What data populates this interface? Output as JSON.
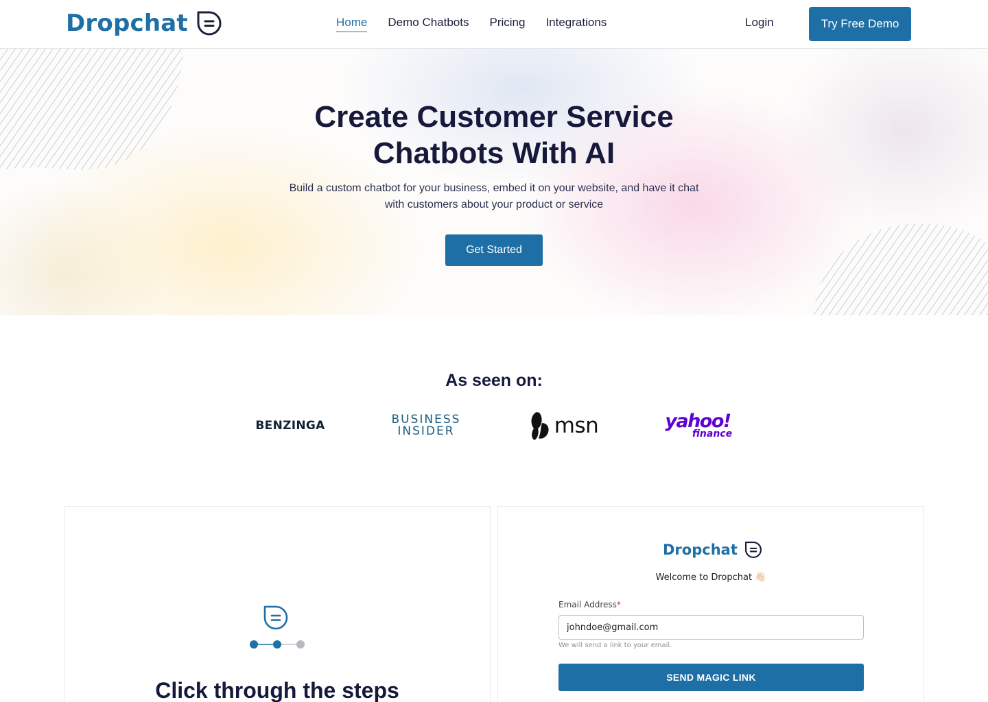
{
  "nav": {
    "brand": "Dropchat",
    "links": [
      {
        "label": "Home",
        "active": true
      },
      {
        "label": "Demo Chatbots",
        "active": false
      },
      {
        "label": "Pricing",
        "active": false
      },
      {
        "label": "Integrations",
        "active": false
      }
    ],
    "login_label": "Login",
    "cta_label": "Try Free Demo"
  },
  "hero": {
    "title_line1": "Create Customer Service",
    "title_line2": "Chatbots With AI",
    "subtitle_line1": "Build a custom chatbot for your business, embed it on your website, and have it chat",
    "subtitle_line2": "with customers about your product or service",
    "cta_label": "Get Started"
  },
  "press": {
    "title": "As seen on:",
    "logos": [
      {
        "name": "benzinga",
        "text": "BENZINGA"
      },
      {
        "name": "business-insider",
        "text_line1": "BUSINESS",
        "text_line2": "INSIDER"
      },
      {
        "name": "msn",
        "text": "msn"
      },
      {
        "name": "yahoo-finance",
        "text_main": "yahoo!",
        "text_sub": "finance"
      }
    ]
  },
  "steps_card": {
    "icon": "chat-bubble-icon",
    "step_count": 3,
    "current_step": 2,
    "title": "Click through the steps"
  },
  "login_card": {
    "brand": "Dropchat",
    "welcome": "Welcome to Dropchat 👋🏻",
    "email_label": "Email Address",
    "required_mark": "*",
    "email_value": "johndoe@gmail.com",
    "email_hint": "We will send a link to your email.",
    "submit_label": "SEND MAGIC LINK"
  },
  "colors": {
    "brand_blue": "#1d6fa5",
    "heading_navy": "#16193b",
    "yahoo_purple": "#5f01d1"
  }
}
